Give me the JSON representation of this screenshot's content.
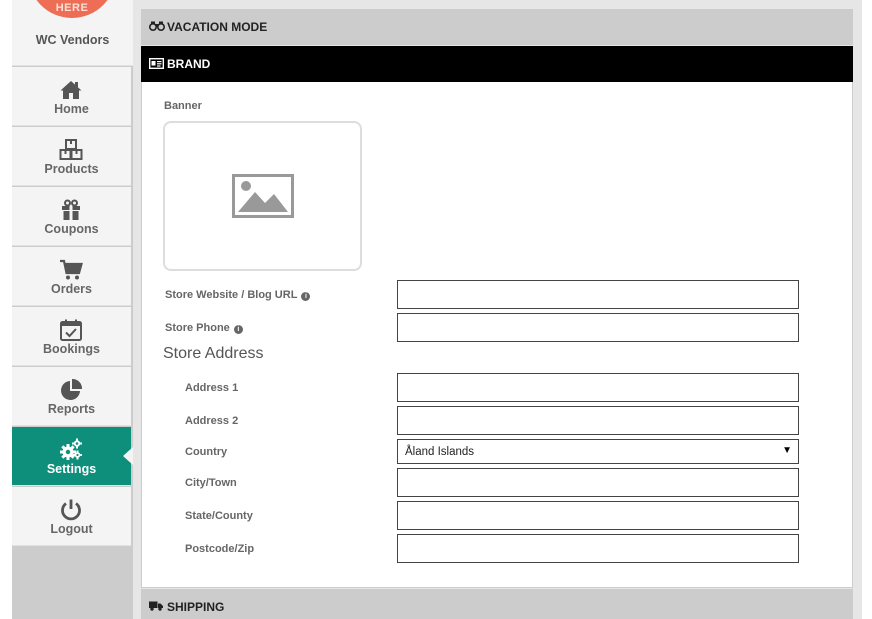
{
  "sidebar": {
    "logo_text": "HERE",
    "vendor_name": "WC Vendors",
    "items": [
      {
        "label": "Home",
        "icon": "home-icon"
      },
      {
        "label": "Products",
        "icon": "boxes-icon"
      },
      {
        "label": "Coupons",
        "icon": "gift-icon"
      },
      {
        "label": "Orders",
        "icon": "cart-icon"
      },
      {
        "label": "Bookings",
        "icon": "calendar-check-icon"
      },
      {
        "label": "Reports",
        "icon": "pie-chart-icon"
      },
      {
        "label": "Settings",
        "icon": "gears-icon",
        "active": true
      },
      {
        "label": "Logout",
        "icon": "power-icon"
      }
    ]
  },
  "panels": {
    "vacation": {
      "title": "VACATION MODE",
      "icon": "binoculars-icon"
    },
    "brand": {
      "title": "BRAND",
      "icon": "id-card-icon"
    },
    "shipping": {
      "title": "SHIPPING",
      "icon": "truck-icon"
    }
  },
  "brand": {
    "banner_label": "Banner",
    "banner_icon": "image-placeholder-icon",
    "website_label": "Store Website / Blog URL",
    "website_value": "",
    "phone_label": "Store Phone",
    "phone_value": "",
    "info_icon": "info-icon"
  },
  "address": {
    "section_title": "Store Address",
    "address1_label": "Address 1",
    "address1_value": "",
    "address2_label": "Address 2",
    "address2_value": "",
    "country_label": "Country",
    "country_value": "Åland Islands",
    "city_label": "City/Town",
    "city_value": "",
    "state_label": "State/County",
    "state_value": "",
    "postcode_label": "Postcode/Zip",
    "postcode_value": ""
  },
  "colors": {
    "accent": "#0e8f7c",
    "logo": "#ee6e55",
    "header_dark": "#000000",
    "panel_header": "#cccccc"
  }
}
